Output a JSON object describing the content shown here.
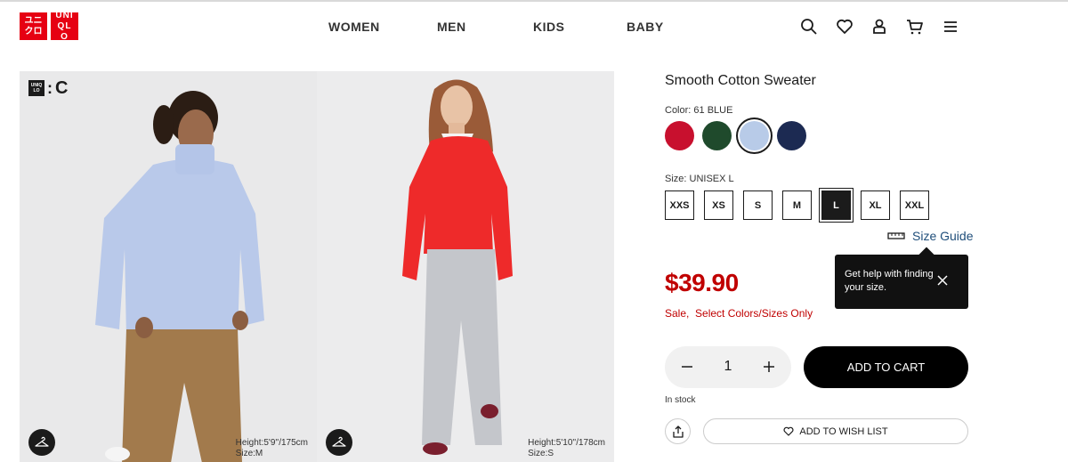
{
  "header": {
    "logo_top": "ユニクロ",
    "logo_bottom": "UNIQLO",
    "nav": [
      "WOMEN",
      "MEN",
      "KIDS",
      "BABY"
    ],
    "icons": [
      "search-icon",
      "heart-icon",
      "account-icon",
      "cart-icon",
      "menu-icon"
    ]
  },
  "gallery": {
    "brand_tag": {
      "logo": "UNIQLO",
      "letter": "C"
    },
    "photos": [
      {
        "model_height": "Height:5'9''/175cm",
        "model_size": "Size:M",
        "icon": "hanger-icon"
      },
      {
        "model_height": "Height:5'10''/178cm",
        "model_size": "Size:S",
        "icon": "hanger-icon"
      }
    ]
  },
  "product": {
    "title": "Smooth Cotton Sweater",
    "color_label": "Color: 61 BLUE",
    "colors": [
      {
        "name": "red",
        "hex": "#c8102e"
      },
      {
        "name": "green",
        "hex": "#1f4a2c"
      },
      {
        "name": "blue",
        "hex": "#b8cbe8",
        "selected": true
      },
      {
        "name": "navy",
        "hex": "#1c2a52"
      }
    ],
    "size_label": "Size: UNISEX L",
    "sizes": [
      "XXS",
      "XS",
      "S",
      "M",
      "L",
      "XL",
      "XXL"
    ],
    "selected_size": "L",
    "size_guide": "Size Guide",
    "tooltip_text": "Get help with finding your size.",
    "price": "$39.90",
    "sale_prefix": "Sale,",
    "sale_text": "Select Colors/Sizes Only",
    "quantity": "1",
    "add_to_cart": "ADD TO CART",
    "stock": "In stock",
    "wish_list": "ADD TO WISH LIST",
    "accent_red": "#c00000"
  }
}
